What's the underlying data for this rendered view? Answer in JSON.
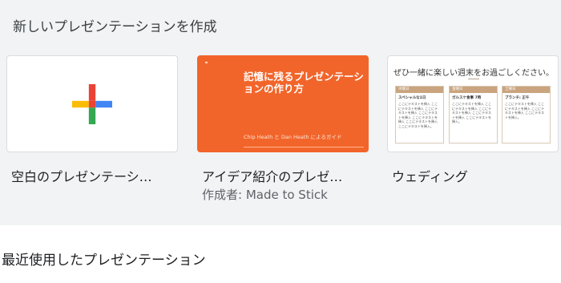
{
  "header": {
    "title": "新しいプレゼンテーションを作成"
  },
  "templates": [
    {
      "label": "空白のプレゼンテーシ…"
    },
    {
      "label": "アイデア紹介のプレゼ…",
      "author": "作成者: Made to Stick",
      "thumb": {
        "title": "記憶に残るプレゼンテーションの作り方",
        "subtitle": "Chip Heath と Dan Heath によるガイド"
      }
    },
    {
      "label": "ウェディング",
      "thumb": {
        "title": "ぜひ一緒に楽しい週末をお過ごしください。",
        "columns": [
          {
            "header": "木曜日",
            "subtitle": "スペシャルな1日",
            "text": "ここにテキストを挿入 ここにテキストを挿入 ここにテキストを挿入 ここにテキストを挿入 ここにテキストを挿入 ここにテキストを挿入 ここにテキストを挿入。"
          },
          {
            "header": "金曜日",
            "subtitle": "ガルスケ食事 7時",
            "text": "ここにテキストを挿入 ここにテキストを挿入 ここにテキストを挿入 ここにテキストを挿入 ここにテキストを挿入。"
          },
          {
            "header": "土曜日",
            "subtitle": "ブランチ: 正午",
            "text": "ここにテキストを挿入 ここにテキストを挿入 ここにテキストを挿入 ここにテキストを挿入。"
          }
        ]
      }
    }
  ],
  "recent": {
    "title": "最近使用したプレゼンテーション"
  },
  "colors": {
    "plus_red": "#ea4335",
    "plus_blue": "#4285f4",
    "plus_green": "#34a853",
    "plus_yellow": "#fbbc04",
    "orange": "#f2652a"
  }
}
